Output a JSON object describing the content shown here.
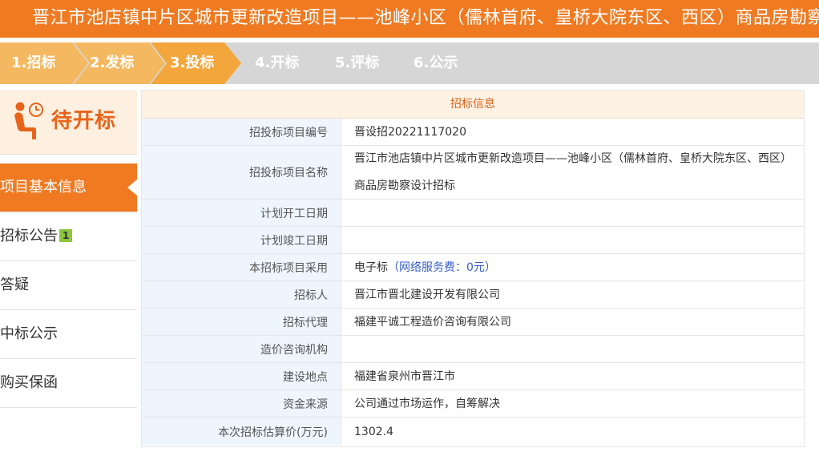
{
  "title": "晋江市池店镇中片区城市更新改造项目——池峰小区（儒林首府、皇桥大院东区、西区）商品房勘察设计招标",
  "steps": [
    {
      "label": "1.招标",
      "state": "done"
    },
    {
      "label": "2.发标",
      "state": "done"
    },
    {
      "label": "3.投标",
      "state": "current"
    },
    {
      "label": "4.开标",
      "state": "pending"
    },
    {
      "label": "5.评标",
      "state": "pending"
    },
    {
      "label": "6.公示",
      "state": "pending"
    }
  ],
  "colors": {
    "accent": "#ef7a22",
    "step_done": "#f4b860",
    "step_current": "#f3a63c",
    "step_pending": "#d6d6d6",
    "badge": "#8dc63f",
    "fee_link": "#3a5fcd"
  },
  "sidebar": {
    "status_icon": "person-waiting-icon",
    "status_label": "待开标",
    "items": [
      {
        "label": "项目基本信息",
        "active": true
      },
      {
        "label": "招标公告",
        "badge": "1"
      },
      {
        "label": "答疑"
      },
      {
        "label": "中标公示"
      },
      {
        "label": "购买保函"
      }
    ]
  },
  "info": {
    "header": "招标信息",
    "rows": [
      {
        "key": "招投标项目编号",
        "value": "晋设招20221117020"
      },
      {
        "key": "招投标项目名称",
        "value": "晋江市池店镇中片区城市更新改造项目——池峰小区（儒林首府、皇桥大院东区、西区）商品房勘察设计招标"
      },
      {
        "key": "计划开工日期",
        "value": ""
      },
      {
        "key": "计划竣工日期",
        "value": ""
      },
      {
        "key": "本招标项目采用",
        "value": "电子标",
        "extra": "（网络服务费：0元）"
      },
      {
        "key": "招标人",
        "value": "晋江市晋北建设开发有限公司"
      },
      {
        "key": "招标代理",
        "value": "福建平诚工程造价咨询有限公司"
      },
      {
        "key": "造价咨询机构",
        "value": ""
      },
      {
        "key": "建设地点",
        "value": "福建省泉州市晋江市"
      },
      {
        "key": "资金来源",
        "value": "公司通过市场运作，自筹解决"
      },
      {
        "key": "本次招标估算价(万元)",
        "value": "1302.4"
      }
    ]
  }
}
